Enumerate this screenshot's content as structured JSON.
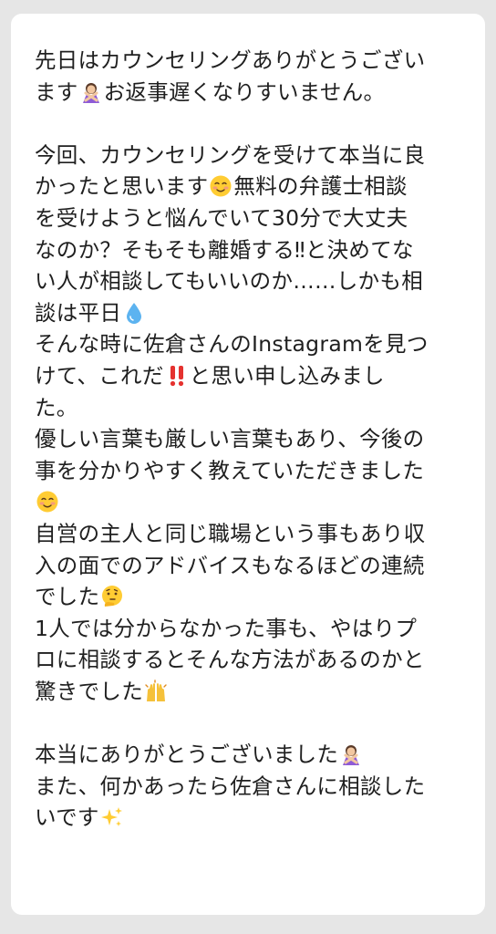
{
  "message": {
    "lines": [
      {
        "text": "先日はカウンセリングありがとうござい",
        "after": "",
        "emoji": ""
      },
      {
        "text": "ます",
        "emoji": "woman-gesturing-no-emoji",
        "after": "お返事遅くなりすいません。"
      },
      {
        "text": "",
        "emoji": "",
        "after": ""
      },
      {
        "text": "今回、カウンセリングを受けて本当に良",
        "emoji": "",
        "after": ""
      },
      {
        "text": "かったと思います",
        "emoji": "smiling-face-emoji",
        "after": "無料の弁護士相談"
      },
      {
        "text": "を受けようと悩んでいて30分で大丈夫",
        "emoji": "",
        "after": ""
      },
      {
        "text": "なのか？そもそも離婚する‼と決めてな",
        "emoji": "",
        "after": ""
      },
      {
        "text": "い人が相談してもいいのか……しかも相",
        "emoji": "",
        "after": ""
      },
      {
        "text": "談は平日",
        "emoji": "droplet-emoji",
        "after": ""
      },
      {
        "text": "そんな時に佐倉さんのInstagramを見つ",
        "emoji": "",
        "after": ""
      },
      {
        "text": "けて、これだ",
        "emoji": "double-exclamation-emoji",
        "after": "と思い申し込みまし"
      },
      {
        "text": "た。",
        "emoji": "",
        "after": ""
      },
      {
        "text": "優しい言葉も厳しい言葉もあり、今後の",
        "emoji": "",
        "after": ""
      },
      {
        "text": "事を分かりやすく教えていただきました",
        "emoji": "",
        "after": ""
      },
      {
        "text": "",
        "emoji": "smiling-face-emoji",
        "after": ""
      },
      {
        "text": "自営の主人と同じ職場という事もあり収",
        "emoji": "",
        "after": ""
      },
      {
        "text": "入の面でのアドバイスもなるほどの連続",
        "emoji": "",
        "after": ""
      },
      {
        "text": "でした",
        "emoji": "thinking-face-emoji",
        "after": ""
      },
      {
        "text": "1人では分からなかった事も、やはりプ",
        "emoji": "",
        "after": ""
      },
      {
        "text": "ロに相談するとそんな方法があるのかと",
        "emoji": "",
        "after": ""
      },
      {
        "text": "驚きでした",
        "emoji": "raising-hands-emoji",
        "after": ""
      },
      {
        "text": "",
        "emoji": "",
        "after": ""
      },
      {
        "text": "本当にありがとうございました",
        "emoji": "woman-gesturing-no-emoji",
        "after": ""
      },
      {
        "text": "また、何かあったら佐倉さんに相談した",
        "emoji": "",
        "after": ""
      },
      {
        "text": "いです",
        "emoji": "sparkles-emoji",
        "after": ""
      }
    ]
  }
}
